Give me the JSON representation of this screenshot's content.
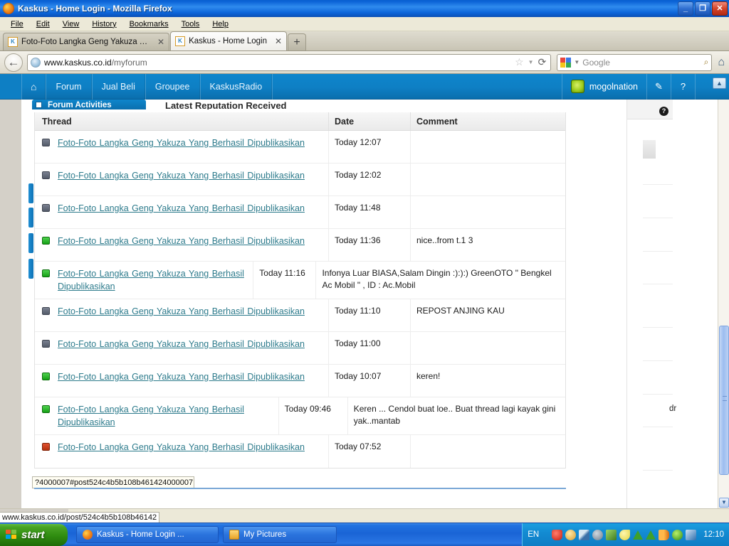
{
  "window": {
    "title": "Kaskus - Home Login - Mozilla Firefox",
    "minimize_label": "_",
    "restore_label": "❐",
    "close_label": "✕"
  },
  "menubar": {
    "items": [
      "File",
      "Edit",
      "View",
      "History",
      "Bookmarks",
      "Tools",
      "Help"
    ]
  },
  "tabs": [
    {
      "label": "Foto-Foto Langka Geng Yakuza Yang Ber...",
      "favicon": "kaskus-icon",
      "close_label": "✕",
      "active": false
    },
    {
      "label": "Kaskus - Home Login",
      "favicon": "kaskus-icon",
      "close_label": "✕",
      "active": true
    }
  ],
  "newtab_label": "+",
  "navbar": {
    "back_label": "←",
    "url_prefix": "www.kaskus.co.id",
    "url_suffix": "/myforum",
    "star_label": "☆",
    "dropdown_label": "▼",
    "reload_label": "⟳",
    "search_placeholder": "Google",
    "search_dropdown_label": "▼",
    "magnify_label": "⌕",
    "home_label": "⌂"
  },
  "kaskus_nav": {
    "home_label": "⌂",
    "items": [
      "Forum",
      "Jual Beli",
      "Groupee",
      "KaskusRadio"
    ],
    "username": "mogolnation",
    "edit_icon_label": "✎",
    "help_icon_label": "?",
    "collapse_label": "▲"
  },
  "page": {
    "forum_activities_tab": "Forum Activities",
    "latest_reputation_heading": "Latest Reputation Received",
    "right_panel_help_label": "?",
    "right_panel_text": "dr"
  },
  "table": {
    "headers": [
      "Thread",
      "Date",
      "Comment"
    ],
    "rows": [
      {
        "status": "gray",
        "thread": "Foto-Foto Langka Geng Yakuza Yang Berhasil Dipublikasikan",
        "date": "Today 12:07",
        "comment": "",
        "hovered": false
      },
      {
        "status": "gray",
        "thread": "Foto-Foto Langka Geng Yakuza Yang Berhasil Dipublikasikan",
        "date": "Today 12:02",
        "comment": "",
        "hovered": true
      },
      {
        "status": "gray",
        "thread": "Foto-Foto Langka Geng Yakuza Yang Berhasil Dipublikasikan",
        "date": "Today 11:48",
        "comment": "",
        "hovered": false
      },
      {
        "status": "green",
        "thread": "Foto-Foto Langka Geng Yakuza Yang Berhasil Dipublikasikan",
        "date": "Today 11:36",
        "comment": "nice..from t.1 3",
        "hovered": false
      },
      {
        "status": "green",
        "thread": "Foto-Foto Langka Geng Yakuza Yang Berhasil Dipublikasikan",
        "date": "Today 11:16",
        "comment": "Infonya Luar BIASA,Salam Dingin :):):) GreenOTO \" Bengkel Ac Mobil \" , ID : Ac.Mobil",
        "hovered": false
      },
      {
        "status": "gray",
        "thread": "Foto-Foto Langka Geng Yakuza Yang Berhasil Dipublikasikan",
        "date": "Today 11:10",
        "comment": "REPOST ANJING KAU",
        "hovered": false
      },
      {
        "status": "gray",
        "thread": "Foto-Foto Langka Geng Yakuza Yang Berhasil Dipublikasikan",
        "date": "Today 11:00",
        "comment": "",
        "hovered": false
      },
      {
        "status": "green",
        "thread": "Foto-Foto Langka Geng Yakuza Yang Berhasil Dipublikasikan",
        "date": "Today 10:07",
        "comment": "keren!",
        "hovered": false
      },
      {
        "status": "green",
        "thread": "Foto-Foto Langka Geng Yakuza Yang Berhasil Dipublikasikan",
        "date": "Today 09:46",
        "comment": "Keren ... Cendol buat loe.. Buat thread lagi kayak gini yak..mantab",
        "hovered": false
      },
      {
        "status": "red",
        "thread": "Foto-Foto Langka Geng Yakuza Yang Berhasil Dipublikasikan",
        "date": "Today 07:52",
        "comment": "",
        "hovered": false
      }
    ]
  },
  "anchor_preview": "?4000007#post524c4b5b108b461424000007",
  "statusbar": {
    "link": "www.kaskus.co.id/post/524c4b5b108b46142"
  },
  "taskbar": {
    "start_label": "start",
    "items": [
      {
        "label": "Kaskus - Home Login ...",
        "icon": "firefox-icon"
      },
      {
        "label": "My Pictures",
        "icon": "folder-icon"
      }
    ],
    "language": "EN",
    "clock": "12:10"
  },
  "colors": {
    "kaskus_blue": "#0e7fc4",
    "link_teal": "#2d7b8c",
    "status_green": "#15a015",
    "status_red": "#b5310f",
    "status_gray": "#545b6a",
    "xp_taskbar_blue": "#2172e0",
    "start_green": "#2f8c10"
  }
}
